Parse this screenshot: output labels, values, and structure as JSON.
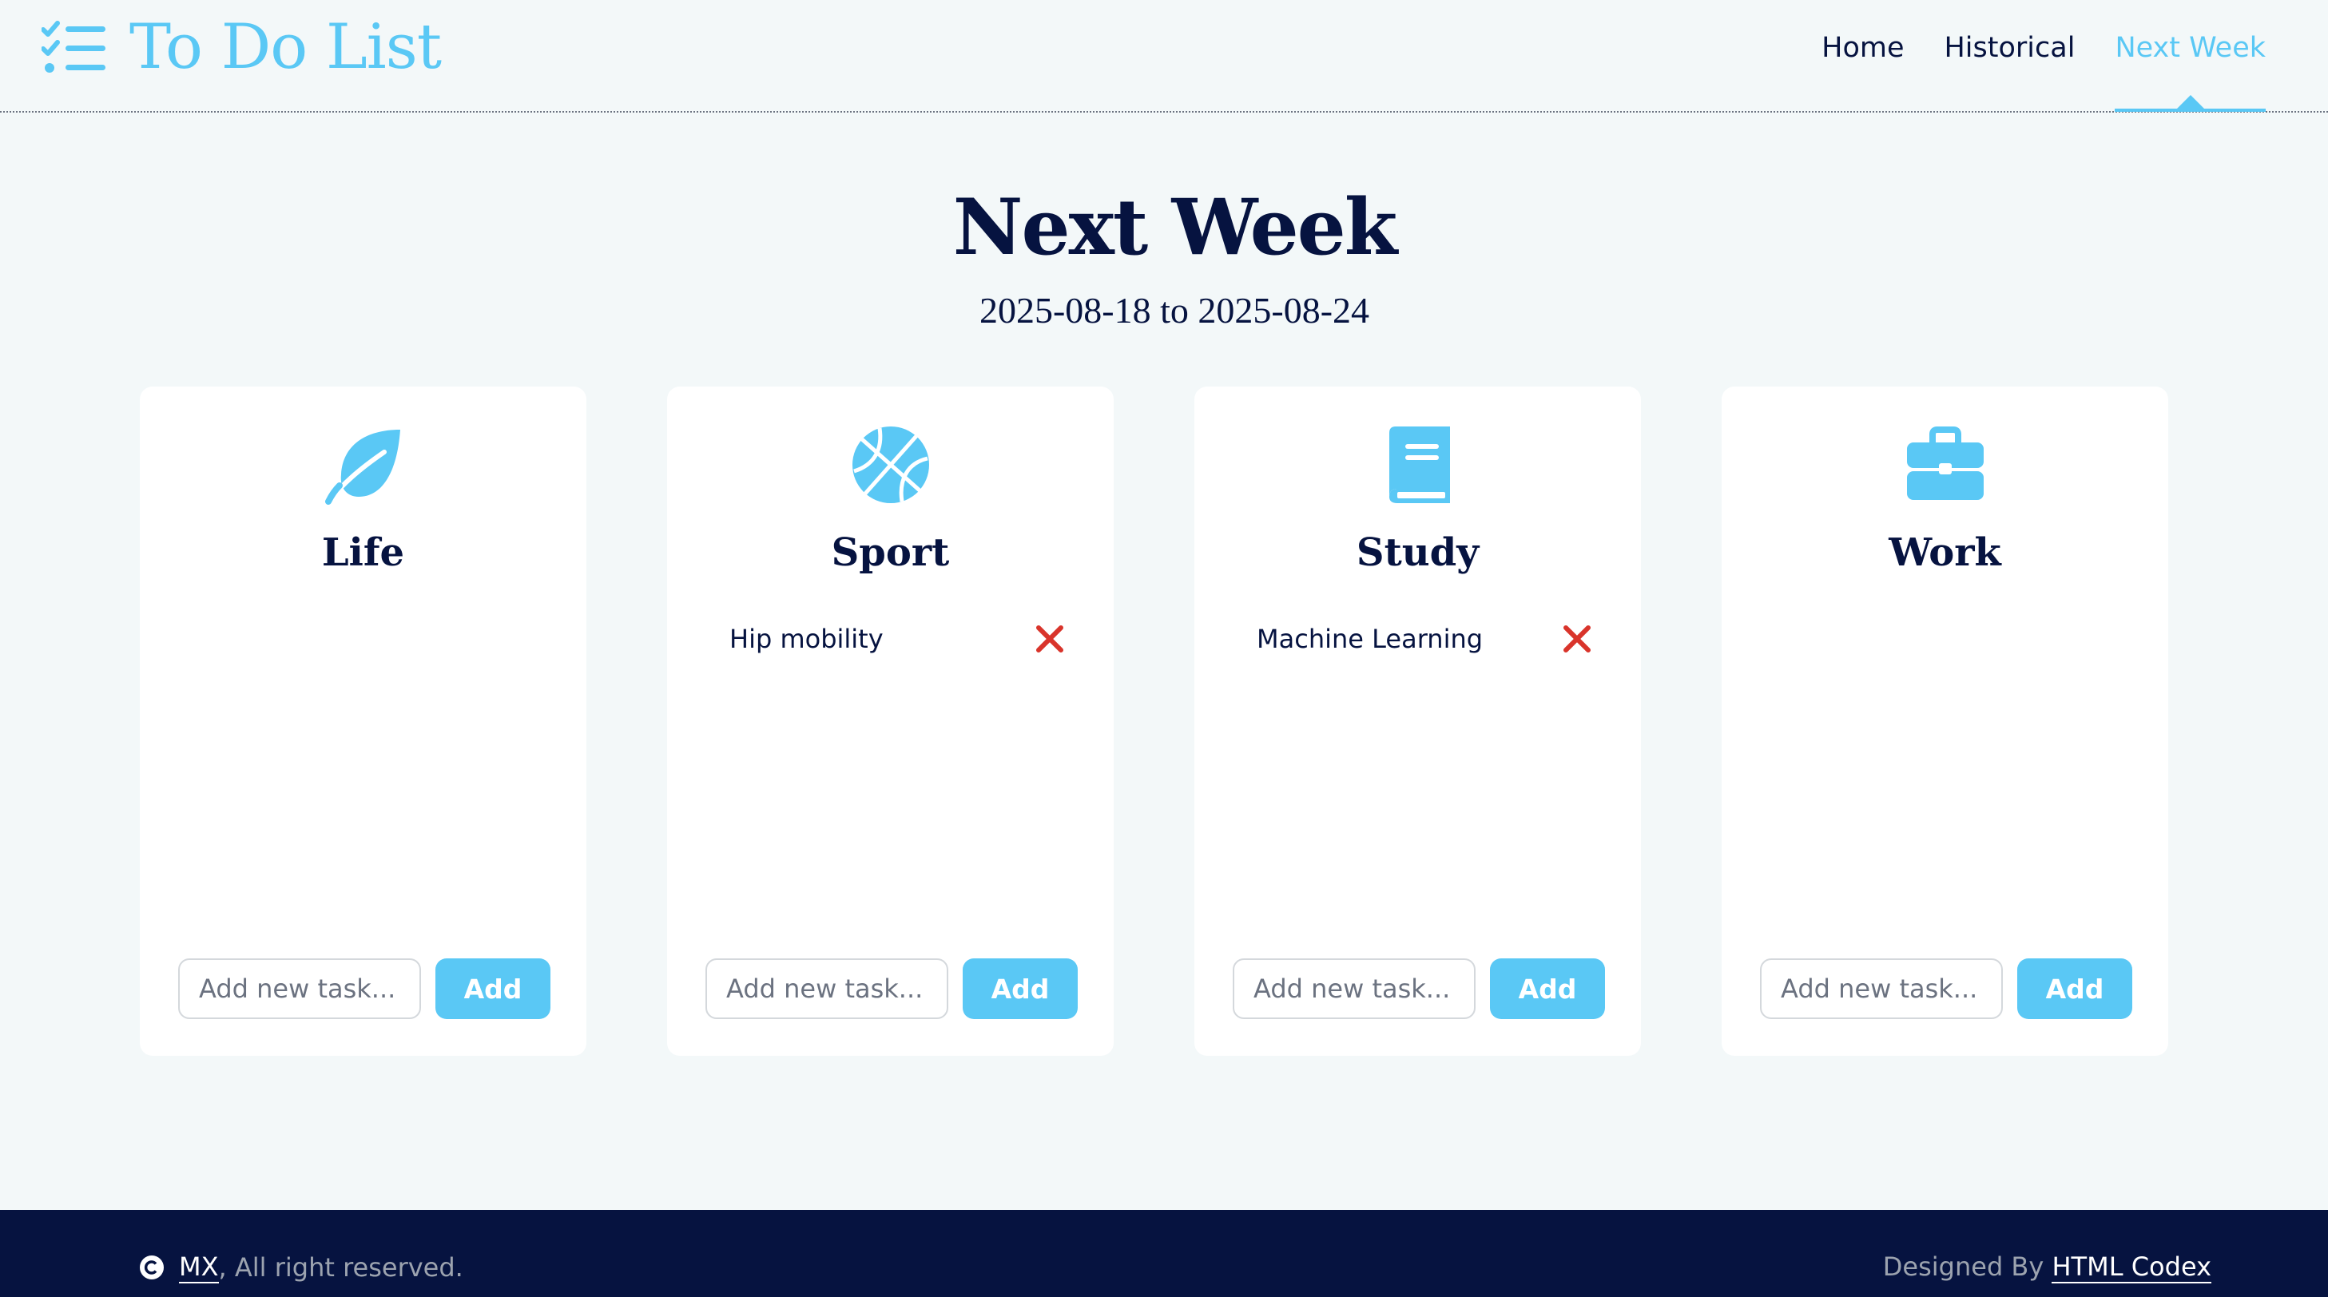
{
  "brand": {
    "title": "To Do List",
    "icon": "list-check-icon"
  },
  "nav": {
    "home": "Home",
    "historical": "Historical",
    "next_week": "Next Week",
    "active": "Next Week"
  },
  "page": {
    "title": "Next Week",
    "range": "2025-08-18 to 2025-08-24"
  },
  "colors": {
    "accent": "#5ac8f5",
    "navy": "#061340",
    "delete": "#d9342b",
    "background": "#f3f8f9"
  },
  "cards": [
    {
      "title": "Life",
      "icon": "leaf-icon",
      "tasks": [],
      "input_placeholder": "Add new task...",
      "add_label": "Add"
    },
    {
      "title": "Sport",
      "icon": "basketball-icon",
      "tasks": [
        "Hip mobility"
      ],
      "input_placeholder": "Add new task...",
      "add_label": "Add"
    },
    {
      "title": "Study",
      "icon": "book-icon",
      "tasks": [
        "Machine Learning"
      ],
      "input_placeholder": "Add new task...",
      "add_label": "Add"
    },
    {
      "title": "Work",
      "icon": "briefcase-icon",
      "tasks": [],
      "input_placeholder": "Add new task...",
      "add_label": "Add"
    }
  ],
  "footer": {
    "owner": "MX",
    "rights": ", All right reserved.",
    "designed_by": "Designed By ",
    "designer": "HTML Codex"
  }
}
